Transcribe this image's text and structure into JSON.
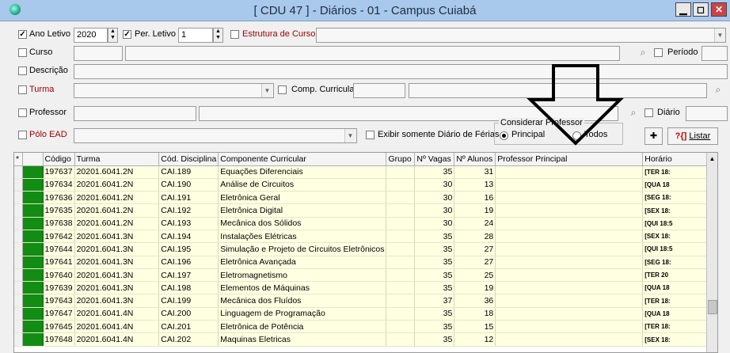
{
  "window": {
    "title": "[ CDU 47 ] - Diários - 01 - Campus Cuiabá",
    "minimize": "▁",
    "maximize": "◻",
    "close": "✕"
  },
  "filters": {
    "ano_letivo_label": "Ano Letivo",
    "ano_letivo_value": "2020",
    "per_letivo_label": "Per. Letivo",
    "per_letivo_value": "1",
    "estrutura_label": "Estrutura de Curso",
    "curso_label": "Curso",
    "periodo_label": "Período",
    "descricao_label": "Descrição",
    "turma_label": "Turma",
    "comp_curricular_label": "Comp. Curricular",
    "professor_label": "Professor",
    "diario_label": "Diário",
    "polo_label": "Pólo EAD",
    "somente_ferias_label": "Exibir somente Diário de Férias",
    "considerar_label": "Considerar Professor",
    "principal_label": "Principal",
    "todos_label": "Todos",
    "listar_label": "Listar",
    "listar_icon": "?{]",
    "add_icon": "✚",
    "check_mark": "✓"
  },
  "table": {
    "columns": [
      "*",
      "",
      "Código",
      "Turma",
      "Cód. Disciplina",
      "Componente Curricular",
      "Grupo",
      "Nº Vagas",
      "Nº Alunos",
      "Professor Principal",
      "Horário"
    ],
    "rows": [
      {
        "codigo": "197637",
        "turma": "20201.6041.2N",
        "cod_disciplina": "CAI.189",
        "componente": "Equações Diferenciais",
        "vagas": "35",
        "alunos": "31",
        "horario": "[TER 18:"
      },
      {
        "codigo": "197634",
        "turma": "20201.6041.2N",
        "cod_disciplina": "CAI.190",
        "componente": "Análise de Circuitos",
        "vagas": "30",
        "alunos": "13",
        "horario": "[QUA 18"
      },
      {
        "codigo": "197636",
        "turma": "20201.6041.2N",
        "cod_disciplina": "CAI.191",
        "componente": "Eletrônica Geral",
        "vagas": "30",
        "alunos": "16",
        "horario": "[SEG 18:"
      },
      {
        "codigo": "197635",
        "turma": "20201.6041.2N",
        "cod_disciplina": "CAI.192",
        "componente": "Eletrônica Digital",
        "vagas": "30",
        "alunos": "19",
        "horario": "[SEX 18:"
      },
      {
        "codigo": "197638",
        "turma": "20201.6041.2N",
        "cod_disciplina": "CAI.193",
        "componente": "Mecânica dos Sólidos",
        "vagas": "30",
        "alunos": "24",
        "horario": "[QUI 18:5"
      },
      {
        "codigo": "197642",
        "turma": "20201.6041.3N",
        "cod_disciplina": "CAI.194",
        "componente": "Instalações Elétricas",
        "vagas": "35",
        "alunos": "28",
        "horario": "[SEX 18:"
      },
      {
        "codigo": "197644",
        "turma": "20201.6041.3N",
        "cod_disciplina": "CAI.195",
        "componente": "Simulação e Projeto de Circuitos Eletrônicos",
        "vagas": "35",
        "alunos": "27",
        "horario": "[QUI 18:5"
      },
      {
        "codigo": "197641",
        "turma": "20201.6041.3N",
        "cod_disciplina": "CAI.196",
        "componente": "Eletrônica Avançada",
        "vagas": "35",
        "alunos": "27",
        "horario": "[SEG 18:"
      },
      {
        "codigo": "197640",
        "turma": "20201.6041.3N",
        "cod_disciplina": "CAI.197",
        "componente": "Eletromagnetismo",
        "vagas": "35",
        "alunos": "25",
        "horario": "[TER 20"
      },
      {
        "codigo": "197639",
        "turma": "20201.6041.3N",
        "cod_disciplina": "CAI.198",
        "componente": "Elementos de Máquinas",
        "vagas": "35",
        "alunos": "19",
        "horario": "[QUA 18"
      },
      {
        "codigo": "197643",
        "turma": "20201.6041.3N",
        "cod_disciplina": "CAI.199",
        "componente": "Mecânica dos Fluídos",
        "vagas": "37",
        "alunos": "36",
        "horario": "[TER 18:"
      },
      {
        "codigo": "197647",
        "turma": "20201.6041.4N",
        "cod_disciplina": "CAI.200",
        "componente": "Linguagem de Programação",
        "vagas": "35",
        "alunos": "18",
        "horario": "[QUA 18"
      },
      {
        "codigo": "197645",
        "turma": "20201.6041.4N",
        "cod_disciplina": "CAI.201",
        "componente": "Eletrônica de Potência",
        "vagas": "35",
        "alunos": "15",
        "horario": "[TER 18:"
      },
      {
        "codigo": "197648",
        "turma": "20201.6041.4N",
        "cod_disciplina": "CAI.202",
        "componente": "Maquinas Eletricas",
        "vagas": "35",
        "alunos": "12",
        "horario": "[SEX 18:"
      }
    ]
  },
  "colors": {
    "titlebar": "#a8c8ec",
    "row_bg": "#ffffe1",
    "status_green": "#128c12",
    "required_label": "#a00000"
  }
}
